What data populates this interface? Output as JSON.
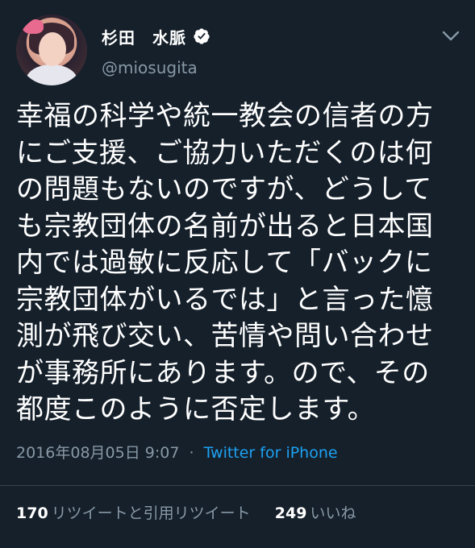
{
  "user": {
    "display_name": "杉田　水脈",
    "handle": "@miosugita",
    "verified": true
  },
  "tweet": {
    "lines": [
      "幸福の科学や統一教会の信者の方",
      "にご支援、ご協力いただくのは何",
      "の問題もないのですが、どうして",
      "も宗教団体の名前が出ると日本国",
      "内では過敏に反応して「バックに",
      "宗教団体がいるでは」と言った憶",
      "測が飛び交い、苦情や問い合わせ",
      "が事務所にあります。ので、その",
      "都度このように否定します。"
    ],
    "timestamp": "2016年08月05日 9:07",
    "separator": "·",
    "source": "Twitter for iPhone"
  },
  "stats": {
    "retweets_count": "170",
    "retweets_label": "リツイートと引用リツイート",
    "likes_count": "249",
    "likes_label": "いいね"
  },
  "icons": {
    "verified": "verified-badge-icon",
    "menu": "chevron-down-icon"
  },
  "colors": {
    "background": "#15202b",
    "text": "#ffffff",
    "muted": "#8899a6",
    "link": "#1da1f2"
  }
}
